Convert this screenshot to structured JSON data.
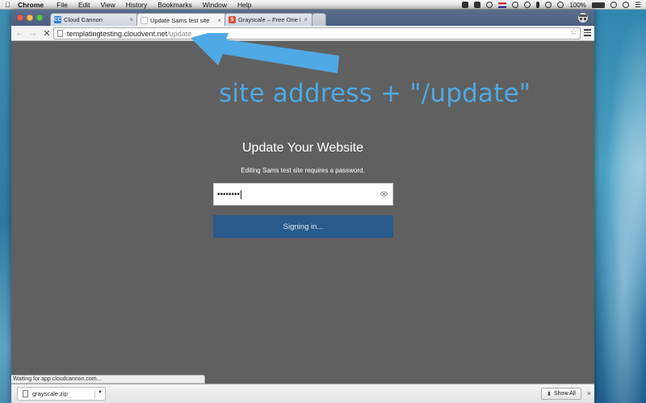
{
  "menubar": {
    "app_name": "Chrome",
    "items": [
      "File",
      "Edit",
      "View",
      "History",
      "Bookmarks",
      "Window",
      "Help"
    ],
    "battery": "100%"
  },
  "tabs": [
    {
      "title": "Cloud Cannon",
      "favicon": "cloudcannon-icon",
      "favicon_color": "#2f7bd6",
      "favicon_text": "CC",
      "active": false
    },
    {
      "title": "Update Sams test site",
      "favicon": "page-icon",
      "favicon_color": "#bdbdbd",
      "favicon_text": "",
      "active": true
    },
    {
      "title": "Grayscale – Free One Page",
      "favicon": "s-icon",
      "favicon_color": "#d9533a",
      "favicon_text": "S",
      "active": false
    }
  ],
  "omnibox": {
    "host": "templatingtesting.cloudvent.net",
    "path": "/update"
  },
  "annotation": {
    "text": "site address + \"/update\"",
    "color": "#4fa9e4"
  },
  "page": {
    "heading": "Update Your Website",
    "subtext": "Editing Sams test site requires a password.",
    "password_mask": "••••••••",
    "button_label": "Signing in...",
    "button_color": "#285a8c",
    "background": "#606060"
  },
  "status": {
    "text": "Waiting for app.cloudcannon.com..."
  },
  "downloads": {
    "file": "grayscale.zip",
    "show_all": "Show All"
  }
}
